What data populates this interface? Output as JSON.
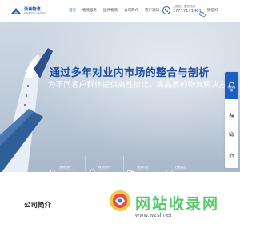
{
  "header": {
    "logo_cn": "浙商物流",
    "logo_en": "ZHESHANG LOGISTICS",
    "nav": [
      "首页",
      "物流服务",
      "国外物流",
      "公司简介",
      "客户须知"
    ],
    "phone_label": "全国统一服务热线",
    "phone_number": "17717171401",
    "wechat_label": "微信扫"
  },
  "hero": {
    "title": "通过多年对业内市场的整合与剖析",
    "subtitle": "为不同客户群体提供高性价比、高品质的物流解决方案"
  },
  "services": [
    {
      "cn": "货物追踪",
      "en": "Cargo tracking",
      "icon": "search-icon"
    },
    {
      "cn": "联系我们",
      "en": "Contact",
      "icon": "phone-icon"
    },
    {
      "cn": "服务项目",
      "en": "Service",
      "icon": "truck-icon"
    },
    {
      "cn": "在线留言",
      "en": "Comment",
      "icon": "message-icon"
    }
  ],
  "side_bar": {
    "top_label": "在线客服",
    "items": [
      {
        "label": "电话",
        "icon": "phone-icon"
      },
      {
        "label": "微信",
        "icon": "wechat-icon"
      },
      {
        "label": "置顶",
        "icon": "arrow-up-icon"
      }
    ]
  },
  "about": {
    "title": "公司简介"
  },
  "watermark": {
    "text": "网站收录网",
    "url": "www.wzsl.net"
  },
  "colors": {
    "brand": "#1a5fc2",
    "title_blue": "#1b4f9e",
    "watermark_green": "#57c86b"
  }
}
